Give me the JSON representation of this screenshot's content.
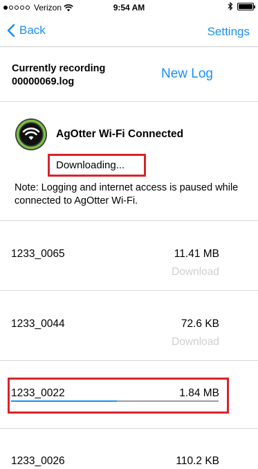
{
  "status_bar": {
    "carrier": "Verizon",
    "time": "9:54 AM",
    "signal_bars": 1,
    "signal_total": 5
  },
  "nav": {
    "back_label": "Back",
    "settings_label": "Settings"
  },
  "recording": {
    "label": "Currently recording",
    "filename": "00000069.log",
    "new_log_label": "New Log"
  },
  "wifi": {
    "title": "AgOtter Wi-Fi Connected",
    "status": "Downloading...",
    "note": "Note: Logging and internet access is paused while connected to AgOtter Wi-Fi."
  },
  "files": [
    {
      "name": "1233_0065",
      "size": "11.41 MB",
      "action": "Download"
    },
    {
      "name": "1233_0044",
      "size": "72.6 KB",
      "action": "Download"
    },
    {
      "name": "1233_0022",
      "size": "1.84 MB",
      "progress": 0.51
    },
    {
      "name": "1233_0026",
      "size": "110.2 KB"
    }
  ],
  "colors": {
    "accent": "#1a8ef5",
    "highlight": "#d8232a",
    "disabled": "#cfcfcf"
  }
}
